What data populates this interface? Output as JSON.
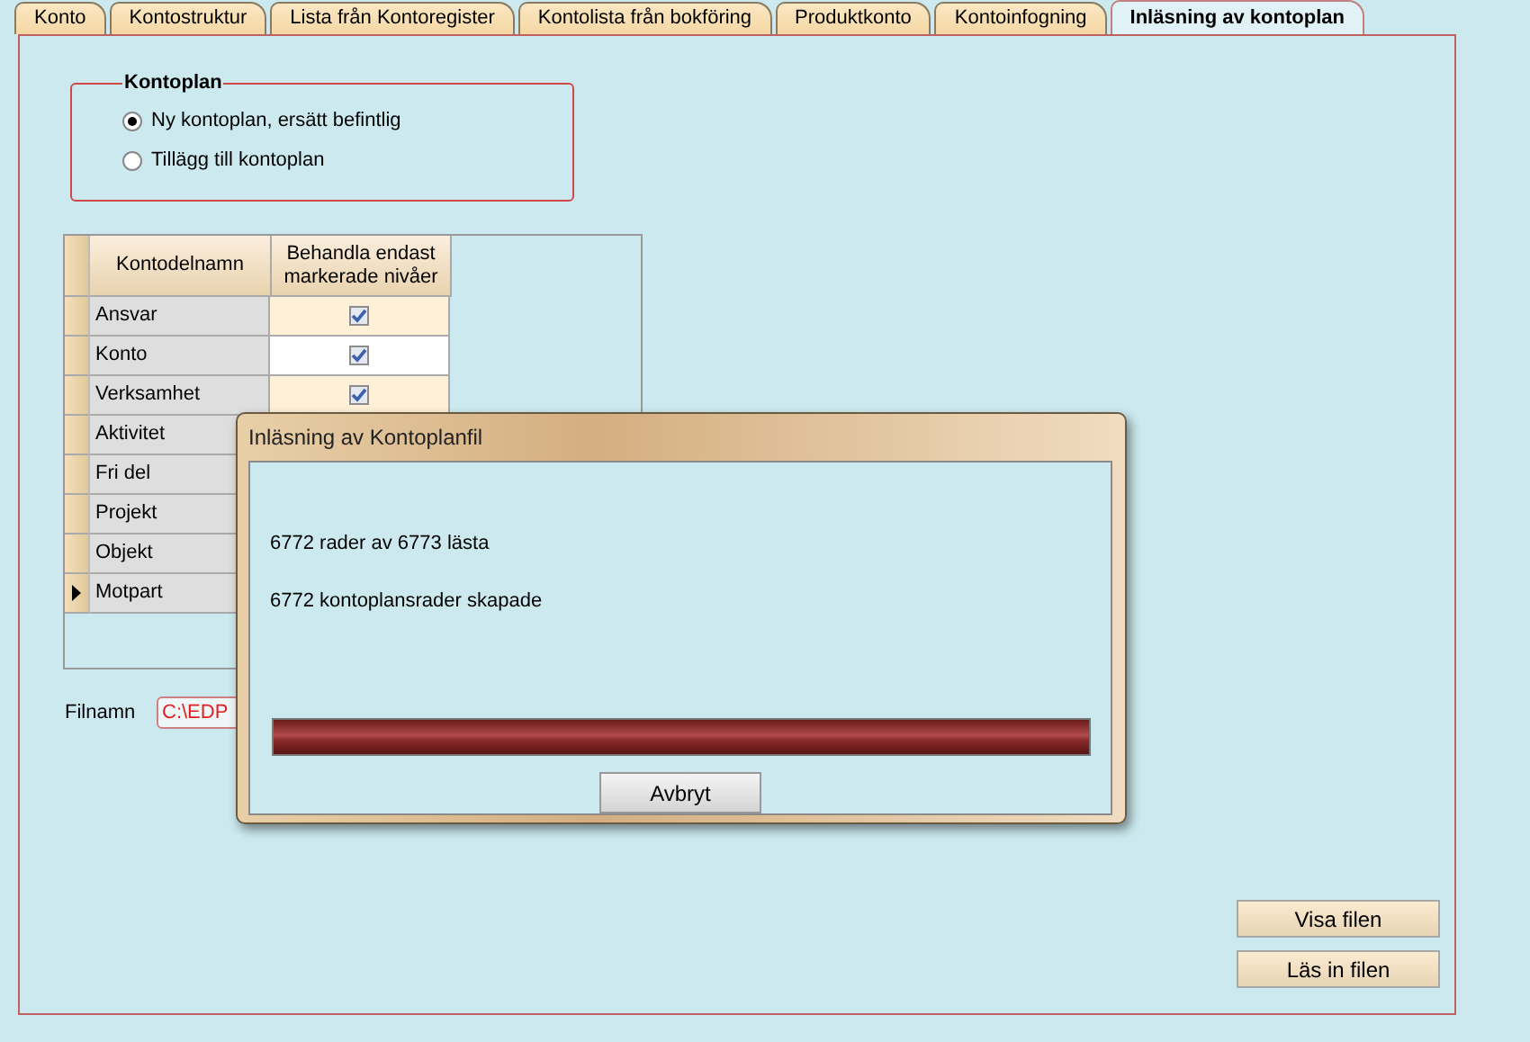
{
  "tabs": [
    {
      "label": "Konto",
      "selected": false
    },
    {
      "label": "Kontostruktur",
      "selected": false
    },
    {
      "label": "Lista från Kontoregister",
      "selected": false
    },
    {
      "label": "Kontolista från bokföring",
      "selected": false
    },
    {
      "label": "Produktkonto",
      "selected": false
    },
    {
      "label": "Kontoinfogning",
      "selected": false
    },
    {
      "label": "Inläsning av kontoplan",
      "selected": true
    }
  ],
  "kontoplan": {
    "title": "Kontoplan",
    "options": [
      {
        "label": "Ny kontoplan, ersätt befintlig",
        "selected": true
      },
      {
        "label": "Tillägg till kontoplan",
        "selected": false
      }
    ]
  },
  "table": {
    "columns": [
      "Kontodelnamn",
      "Behandla endast markerade nivåer"
    ],
    "rows": [
      {
        "name": "Ansvar",
        "checked": true,
        "current": false
      },
      {
        "name": "Konto",
        "checked": true,
        "current": false
      },
      {
        "name": "Verksamhet",
        "checked": true,
        "current": false
      },
      {
        "name": "Aktivitet",
        "current": false
      },
      {
        "name": "Fri del",
        "current": false
      },
      {
        "name": "Projekt",
        "current": false
      },
      {
        "name": "Objekt",
        "current": false
      },
      {
        "name": "Motpart",
        "current": true
      }
    ]
  },
  "filename": {
    "label": "Filnamn",
    "value": "C:\\EDP"
  },
  "buttons": [
    "Visa filen",
    "Läs in filen"
  ],
  "dialog": {
    "title": "Inläsning av Kontoplanfil",
    "lines": [
      "6772 rader av 6773 lästa",
      "6772 kontoplansrader skapade"
    ],
    "progress": {
      "level": 1
    },
    "button": "Avbryt"
  }
}
